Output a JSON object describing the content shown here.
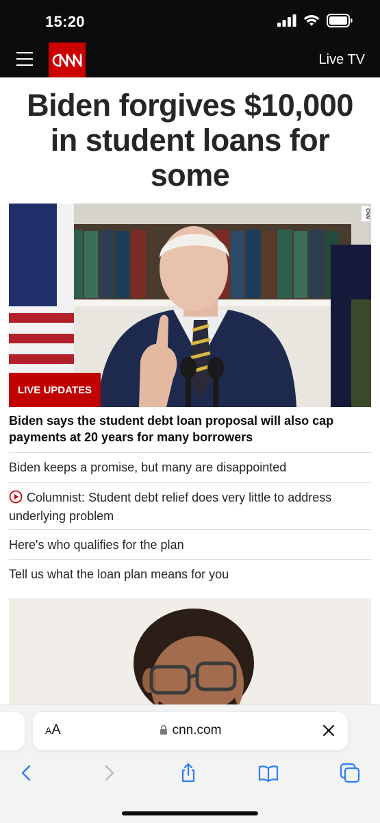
{
  "status_bar": {
    "time": "15:20",
    "icons": [
      "signal-icon",
      "wifi-icon",
      "battery-icon"
    ]
  },
  "nav": {
    "logo_text": "CNN",
    "live_tv_label": "Live TV",
    "brand_color": "#cc0000"
  },
  "article": {
    "headline": "Biden forgives $10,000 in student loans for some",
    "badge_label": "LIVE UPDATES",
    "watermark": "CNN",
    "lead_headline": "Biden says the student debt loan proposal will also cap payments at 20 years for many borrowers",
    "links": [
      {
        "label": "Biden keeps a promise, but many are disappointed",
        "video": false
      },
      {
        "label": "Columnist: Student debt relief does very little to address underlying problem",
        "video": true
      },
      {
        "label": "Here's who qualifies for the plan",
        "video": false
      },
      {
        "label": "Tell us what the loan plan means for you",
        "video": false
      }
    ]
  },
  "browser": {
    "text_size_label": "AA",
    "url": "cnn.com",
    "toolbar_icons": [
      "back-icon",
      "forward-icon",
      "share-icon",
      "bookmarks-icon",
      "tabs-icon"
    ]
  }
}
